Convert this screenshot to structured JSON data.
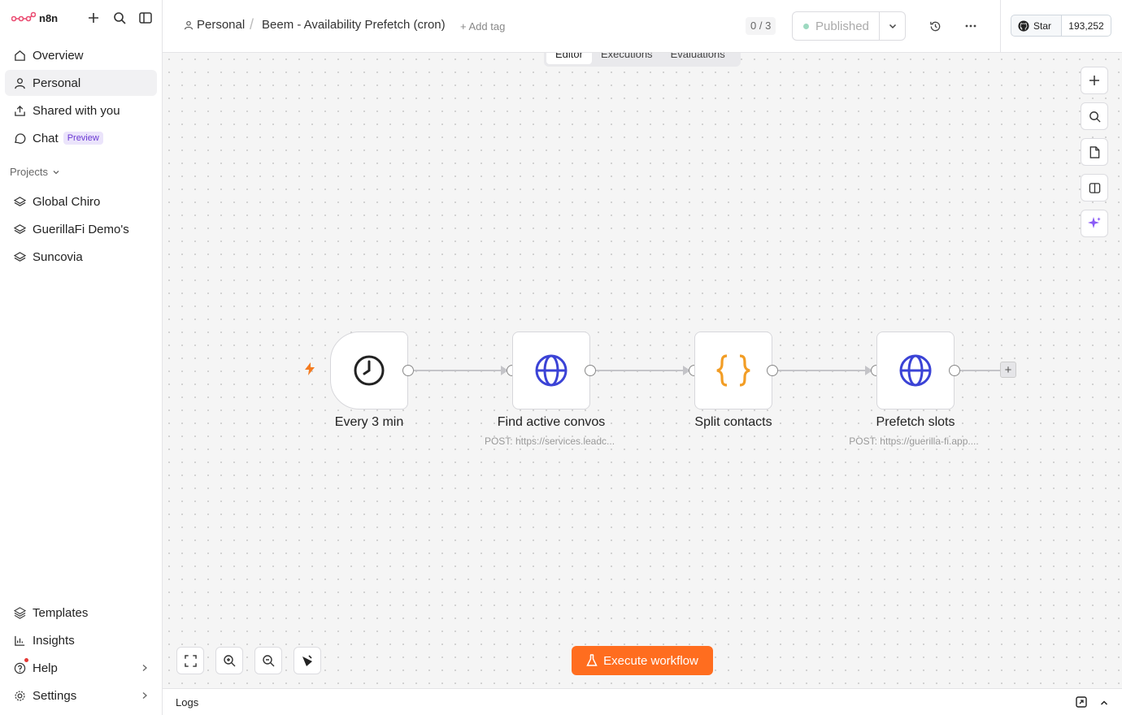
{
  "app": {
    "logo_text": "n8n"
  },
  "sidebar": {
    "nav": [
      {
        "label": "Overview",
        "icon": "home-icon"
      },
      {
        "label": "Personal",
        "icon": "user-icon"
      },
      {
        "label": "Shared with you",
        "icon": "share-icon"
      },
      {
        "label": "Chat",
        "icon": "chat-icon",
        "badge": "Preview"
      }
    ],
    "projects_label": "Projects",
    "projects": [
      {
        "label": "Global Chiro",
        "icon": "layers-icon"
      },
      {
        "label": "GuerillaFi Demo's",
        "icon": "layers-icon"
      },
      {
        "label": "Suncovia",
        "icon": "layers-icon"
      }
    ],
    "bottom": [
      {
        "label": "Templates",
        "icon": "templates-icon"
      },
      {
        "label": "Insights",
        "icon": "chart-icon"
      },
      {
        "label": "Help",
        "icon": "help-icon"
      },
      {
        "label": "Settings",
        "icon": "gear-icon"
      }
    ]
  },
  "header": {
    "breadcrumb_project": "Personal",
    "workflow_name": "Beem - Availability Prefetch (cron)",
    "add_tag": "+ Add tag",
    "counter": "0 / 3",
    "publish_label": "Published",
    "github_star": "Star",
    "github_count": "193,252"
  },
  "tabs": [
    "Editor",
    "Executions",
    "Evaluations"
  ],
  "nodes": [
    {
      "title": "Every 3 min",
      "subtitle": "",
      "icon": "clock-icon"
    },
    {
      "title": "Find active convos",
      "subtitle": "POST: https://services.leadc...",
      "icon": "globe-icon"
    },
    {
      "title": "Split contacts",
      "subtitle": "",
      "icon": "braces-icon"
    },
    {
      "title": "Prefetch slots",
      "subtitle": "POST: https://guerilla-fi.app....",
      "icon": "globe-icon"
    }
  ],
  "execute_button": "Execute workflow",
  "logs_label": "Logs",
  "colors": {
    "accent": "#ff6d1f",
    "http_node": "#3b43d6",
    "code_node": "#f29d25",
    "ai": "#8b5cf6"
  }
}
